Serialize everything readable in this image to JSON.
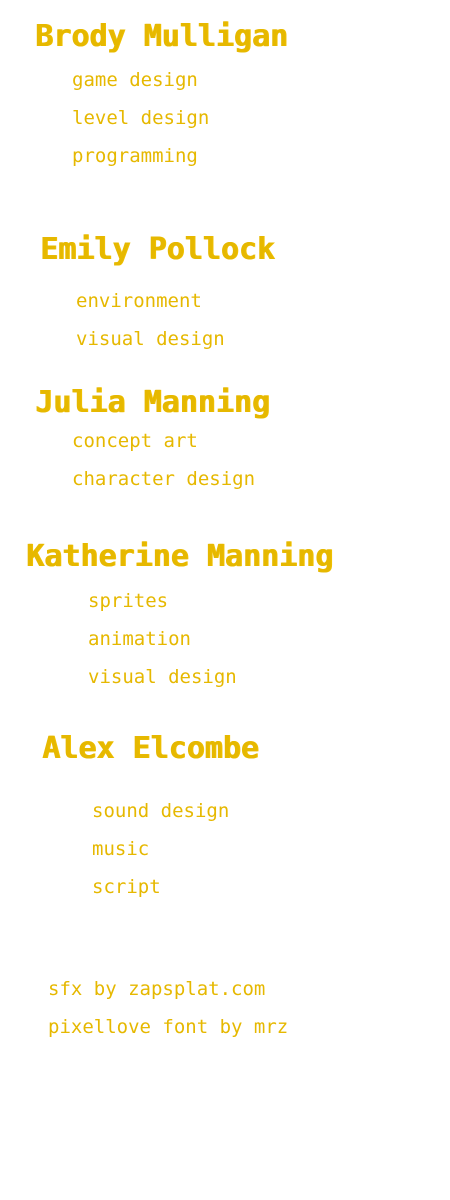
{
  "credits": [
    {
      "name": "Brody Mulligan",
      "roles": [
        "game design",
        "level design",
        "programming"
      ]
    },
    {
      "name": "Emily Pollock",
      "roles": [
        "environment",
        "visual design"
      ]
    },
    {
      "name": "Julia Manning",
      "roles": [
        "concept art",
        "character design"
      ]
    },
    {
      "name": "Katherine Manning",
      "roles": [
        "sprites",
        "animation",
        "visual design"
      ]
    },
    {
      "name": "Alex Elcombe",
      "roles": [
        "sound design",
        "music",
        "script"
      ]
    }
  ],
  "footer": {
    "sfx": "sfx by zapsplat.com",
    "font": "pixellove font by mrz"
  },
  "colors": {
    "text": "#e6b800",
    "background": "#ffffff"
  }
}
